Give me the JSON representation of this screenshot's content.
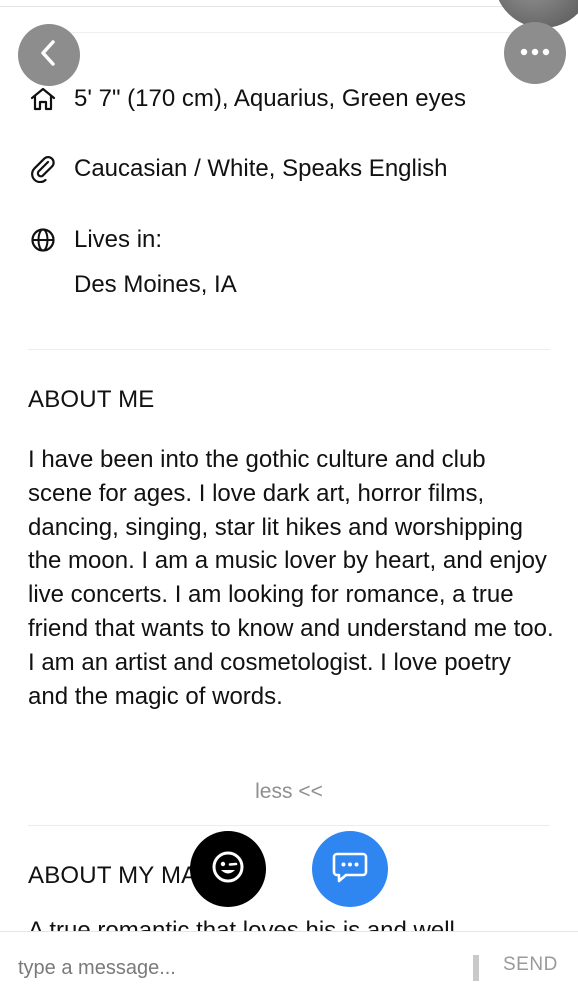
{
  "profile": {
    "details": {
      "height_sign_eyes": "5' 7\" (170 cm), Aquarius, Green eyes",
      "ethnicity_language": "Caucasian / White, Speaks English",
      "lives_in_label": "Lives in:",
      "lives_in_value": "Des Moines, IA"
    },
    "about_me": {
      "title": "ABOUT ME",
      "text": "I have been into the gothic culture and club scene for ages. I love dark art, horror films, dancing, singing, star lit hikes and worshipping the moon. I am a music lover by heart, and enjoy live concerts. I am looking for romance, a true friend that wants to know and understand me too. I am an artist and cosmetologist. I love poetry and the magic of words.",
      "less_label": "less <<"
    },
    "about_my_match": {
      "title": "ABOUT MY MA",
      "peek_text": "A true romantic that loves his is and well"
    }
  },
  "compose": {
    "placeholder": "type a message...",
    "send_label": "SEND"
  },
  "icons": {
    "back": "chevron-left-icon",
    "more": "more-dots-icon",
    "home": "home-icon",
    "paperclip": "paperclip-icon",
    "globe": "globe-icon",
    "emoji": "emoji-wink-icon",
    "chat": "chat-bubble-icon"
  },
  "colors": {
    "chat_fab": "#2f86f0",
    "emoji_fab": "#000000",
    "nav_button": "#8d8d8d",
    "muted_text": "#8f8f8f"
  }
}
